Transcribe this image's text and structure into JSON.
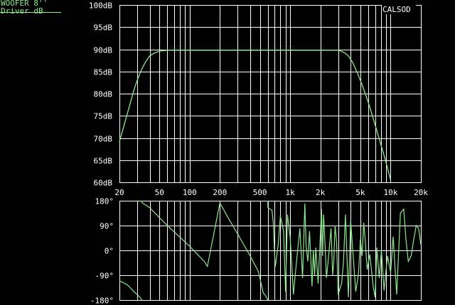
{
  "legend": {
    "line1": "WOOFER 8''",
    "line2": "Driver dB",
    "color": "#8ce68c"
  },
  "brand": "CALSOD",
  "colors": {
    "trace": "#8ce68c",
    "grid": "#ffffff",
    "background": "#000000"
  },
  "chart_data": [
    {
      "type": "line",
      "x_scale": "log",
      "xlim": [
        20,
        20000
      ],
      "ylim": [
        60,
        100
      ],
      "x_ticks": [
        {
          "v": 20,
          "t": "20"
        },
        {
          "v": 50,
          "t": "50"
        },
        {
          "v": 100,
          "t": "100"
        },
        {
          "v": 200,
          "t": "200"
        },
        {
          "v": 500,
          "t": "500"
        },
        {
          "v": 1000,
          "t": "1k"
        },
        {
          "v": 2000,
          "t": "2k"
        },
        {
          "v": 5000,
          "t": "5k"
        },
        {
          "v": 10000,
          "t": "10k"
        },
        {
          "v": 20000,
          "t": "20k"
        }
      ],
      "y_ticks": [
        {
          "v": 100,
          "t": "100dB"
        },
        {
          "v": 95,
          "t": "95dB"
        },
        {
          "v": 90,
          "t": "90dB"
        },
        {
          "v": 85,
          "t": "85dB"
        },
        {
          "v": 80,
          "t": "80dB"
        },
        {
          "v": 75,
          "t": "75dB"
        },
        {
          "v": 70,
          "t": "70dB"
        },
        {
          "v": 65,
          "t": "65dB"
        },
        {
          "v": 60,
          "t": "60dB"
        }
      ],
      "x": [
        20,
        22,
        25,
        28,
        30,
        33,
        36,
        40,
        45,
        50,
        60,
        80,
        100,
        500,
        1000,
        2000,
        3000,
        3200,
        3500,
        3800,
        4200,
        4700,
        5200,
        6000,
        7000,
        8000,
        9000,
        10000
      ],
      "y": [
        69.2,
        72.5,
        77,
        81,
        83,
        85.3,
        87,
        88.5,
        89.2,
        89.6,
        89.8,
        89.8,
        89.8,
        89.8,
        89.8,
        89.8,
        89.8,
        89.6,
        89.2,
        88.5,
        87,
        84.5,
        82,
        78,
        73,
        68.5,
        64.5,
        60.5
      ]
    },
    {
      "type": "line",
      "x_scale": "log",
      "xlim": [
        20,
        20000
      ],
      "ylim": [
        -180,
        180
      ],
      "x_ticks": [],
      "y_ticks": [
        {
          "v": 180,
          "t": "180°"
        },
        {
          "v": 90,
          "t": "90°"
        },
        {
          "v": 0,
          "t": "0°"
        },
        {
          "v": -90,
          "t": "-90°"
        },
        {
          "v": -180,
          "t": "-180°"
        }
      ],
      "x": [
        20,
        24,
        28,
        32,
        33.5,
        40,
        60,
        100,
        140,
        150,
        200,
        240,
        300,
        400,
        480,
        500,
        540,
        560,
        600,
        660,
        680,
        710,
        760,
        800,
        860,
        900,
        940,
        1000,
        1080,
        1130,
        1180,
        1250,
        1330,
        1400,
        1440,
        1500,
        1560,
        1650,
        1700,
        1750,
        1800,
        1900,
        2000,
        2050,
        2100,
        2150,
        2200,
        2300,
        2400,
        2550,
        2650,
        2720,
        2800,
        2900,
        3000,
        3250,
        3400,
        3550,
        3800,
        4000,
        4500,
        4800,
        5000,
        5200,
        5400,
        5600,
        5850,
        6200,
        6700,
        7000,
        7300,
        7700,
        8100,
        8600,
        9300,
        10000,
        10600,
        11500,
        12500,
        13500,
        14200,
        15000,
        16000,
        17000,
        18000,
        19000,
        20000
      ],
      "y": [
        -110,
        -125,
        -150,
        -170,
        173,
        155,
        90,
        15,
        -40,
        -58,
        172,
        120,
        60,
        -20,
        -75,
        -100,
        -155,
        -160,
        155,
        145,
        100,
        -60,
        20,
        125,
        70,
        -150,
        130,
        50,
        -160,
        -80,
        -10,
        80,
        -100,
        170,
        20,
        -40,
        70,
        -130,
        0,
        -90,
        10,
        -120,
        60,
        150,
        -20,
        130,
        60,
        -100,
        -30,
        80,
        -90,
        -40,
        90,
        30,
        -160,
        -120,
        -40,
        130,
        -170,
        110,
        -150,
        -80,
        40,
        -20,
        100,
        30,
        -70,
        -15,
        -130,
        -170,
        10,
        -100,
        0,
        -145,
        -20,
        -80,
        50,
        -160,
        135,
        150,
        40,
        -40,
        -20,
        40,
        90,
        80,
        20
      ]
    }
  ]
}
